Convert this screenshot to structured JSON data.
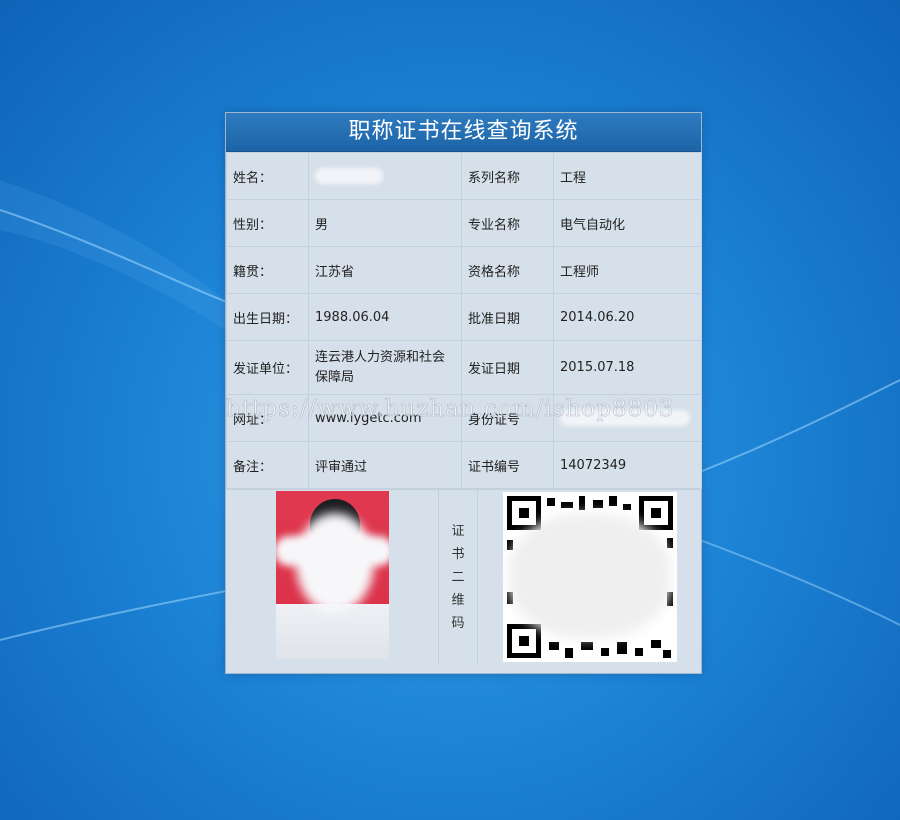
{
  "title": "职称证书在线查询系统",
  "rows": [
    {
      "label_left": "姓名：",
      "value_left": "",
      "label_right": "系列名称",
      "value_right": "工程"
    },
    {
      "label_left": "性别：",
      "value_left": "男",
      "label_right": "专业名称",
      "value_right": "电气自动化"
    },
    {
      "label_left": "籍贯：",
      "value_left": "江苏省",
      "label_right": "资格名称",
      "value_right": "工程师"
    },
    {
      "label_left": "出生日期：",
      "value_left": "1988.06.04",
      "label_right": "批准日期",
      "value_right": "2014.06.20"
    },
    {
      "label_left": "发证单位：",
      "value_left": "连云港人力资源和社会保障局",
      "label_right": "发证日期",
      "value_right": "2015.07.18"
    },
    {
      "label_left": "网址：",
      "value_left": "www.lygetc.com",
      "label_right": "身份证号",
      "value_right": ""
    },
    {
      "label_left": "备注：",
      "value_left": "评审通过",
      "label_right": "证书编号",
      "value_right": "14072349"
    }
  ],
  "qr_label": "证书二维码",
  "watermark": "https://www.huzhan.com/ishop8803",
  "colors": {
    "title_bg": "#1c64a6",
    "panel_bg": "#d6e0ea",
    "desktop_bg": "#1d84d6",
    "photo_bg": "#d93047"
  },
  "icons": {
    "photo": "id-photo-image",
    "qr": "qr-code-image"
  }
}
